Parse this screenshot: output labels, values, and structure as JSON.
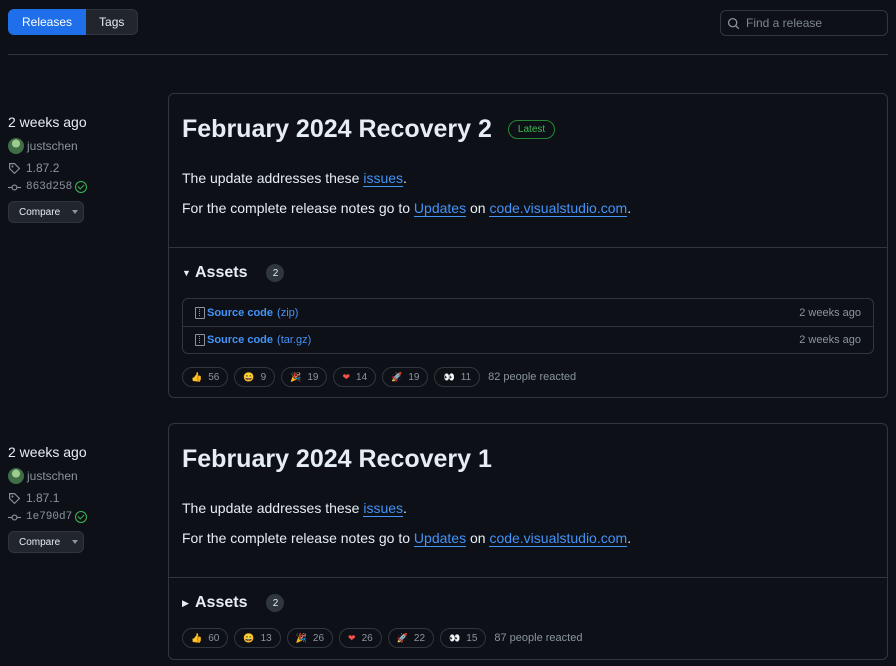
{
  "tabs": [
    {
      "label": "Releases",
      "active": true
    },
    {
      "label": "Tags",
      "active": false
    }
  ],
  "search": {
    "placeholder": "Find a release"
  },
  "releases": [
    {
      "date": "2 weeks ago",
      "author": "justschen",
      "tag": "1.87.2",
      "commit": "863d258",
      "compare_label": "Compare",
      "title": "February 2024 Recovery 2",
      "badge": "Latest",
      "p1_text": "The update addresses these ",
      "p1_link": "issues",
      "p1_end": ".",
      "p2_text": "For the complete release notes go to ",
      "p2_link1": "Updates",
      "p2_mid": " on ",
      "p2_link2": "code.visualstudio.com",
      "p2_end": ".",
      "assets_label": "Assets",
      "assets_count": "2",
      "assets_expanded": true,
      "assets": [
        {
          "name": "Source code",
          "ext": "(zip)",
          "time": "2 weeks ago"
        },
        {
          "name": "Source code",
          "ext": "(tar.gz)",
          "time": "2 weeks ago"
        }
      ],
      "reactions": [
        {
          "icon": "thumbs-up-icon",
          "glyph": "👍",
          "count": "56"
        },
        {
          "icon": "laugh-icon",
          "glyph": "😄",
          "count": "9"
        },
        {
          "icon": "hooray-icon",
          "glyph": "🎉",
          "count": "19"
        },
        {
          "icon": "heart-icon",
          "glyph": "❤",
          "count": "14"
        },
        {
          "icon": "rocket-icon",
          "glyph": "🚀",
          "count": "19"
        },
        {
          "icon": "eyes-icon",
          "glyph": "👀",
          "count": "11"
        }
      ],
      "reacted_text": "82 people reacted"
    },
    {
      "date": "2 weeks ago",
      "author": "justschen",
      "tag": "1.87.1",
      "commit": "1e790d7",
      "compare_label": "Compare",
      "title": "February 2024 Recovery 1",
      "p1_text": "The update addresses these ",
      "p1_link": "issues",
      "p1_end": ".",
      "p2_text": "For the complete release notes go to ",
      "p2_link1": "Updates",
      "p2_mid": " on ",
      "p2_link2": "code.visualstudio.com",
      "p2_end": ".",
      "assets_label": "Assets",
      "assets_count": "2",
      "assets_expanded": false,
      "reactions": [
        {
          "icon": "thumbs-up-icon",
          "glyph": "👍",
          "count": "60"
        },
        {
          "icon": "laugh-icon",
          "glyph": "😄",
          "count": "13"
        },
        {
          "icon": "hooray-icon",
          "glyph": "🎉",
          "count": "26"
        },
        {
          "icon": "heart-icon",
          "glyph": "❤",
          "count": "26"
        },
        {
          "icon": "rocket-icon",
          "glyph": "🚀",
          "count": "22"
        },
        {
          "icon": "eyes-icon",
          "glyph": "👀",
          "count": "15"
        }
      ],
      "reacted_text": "87 people reacted"
    }
  ]
}
